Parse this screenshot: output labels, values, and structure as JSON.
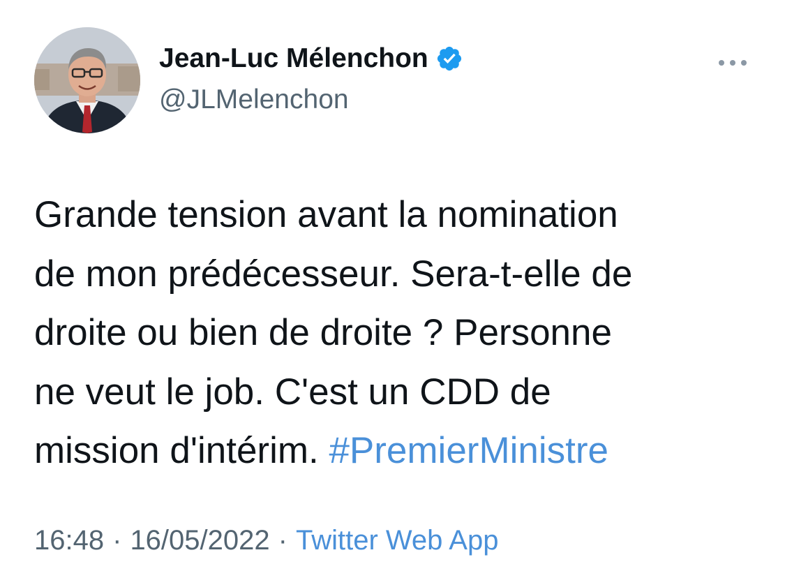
{
  "author": {
    "name": "Jean-Luc Mélenchon",
    "handle": "@JLMelenchon",
    "verified": true,
    "avatar_icon": "profile-photo-icon"
  },
  "more_icon": "more-options-icon",
  "tweet": {
    "text_lines": [
      "Grande tension avant la nomination",
      "de mon prédécesseur. Sera-t-elle de",
      "droite ou bien de droite ? Personne",
      "ne veut le job. C'est un CDD de",
      "mission d'intérim. "
    ],
    "hashtag": "#PremierMinistre"
  },
  "meta": {
    "time": "16:48",
    "separator1": "·",
    "date": "16/05/2022",
    "separator2": "·",
    "source": "Twitter Web App"
  },
  "colors": {
    "text": "#0f1419",
    "secondary": "#536471",
    "link": "#4a90d9",
    "verified": "#1d9bf0"
  }
}
